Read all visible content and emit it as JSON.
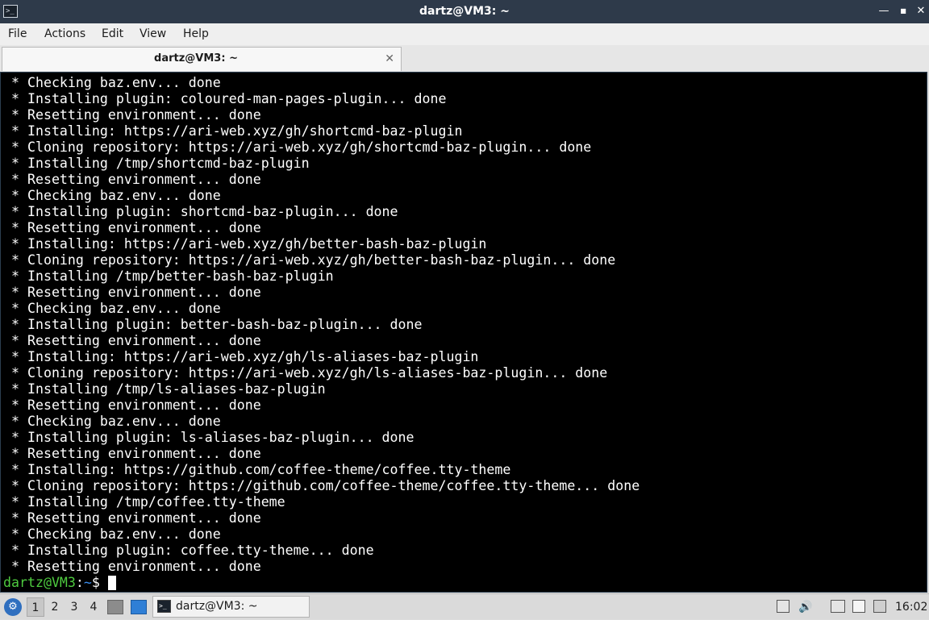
{
  "window": {
    "title": "dartz@VM3: ~",
    "app_icon": "terminal-icon",
    "controls": [
      "minimize",
      "maximize",
      "close"
    ]
  },
  "menubar": {
    "items": [
      "File",
      "Actions",
      "Edit",
      "View",
      "Help"
    ]
  },
  "tabs": [
    {
      "label": "dartz@VM3: ~",
      "close_glyph": "✕"
    }
  ],
  "terminal": {
    "background": "#000000",
    "foreground": "#ffffff",
    "lines": [
      " * Checking baz.env... done",
      " * Installing plugin: coloured-man-pages-plugin... done",
      " * Resetting environment... done",
      " * Installing: https://ari-web.xyz/gh/shortcmd-baz-plugin",
      " * Cloning repository: https://ari-web.xyz/gh/shortcmd-baz-plugin... done",
      " * Installing /tmp/shortcmd-baz-plugin",
      " * Resetting environment... done",
      " * Checking baz.env... done",
      " * Installing plugin: shortcmd-baz-plugin... done",
      " * Resetting environment... done",
      " * Installing: https://ari-web.xyz/gh/better-bash-baz-plugin",
      " * Cloning repository: https://ari-web.xyz/gh/better-bash-baz-plugin... done",
      " * Installing /tmp/better-bash-baz-plugin",
      " * Resetting environment... done",
      " * Checking baz.env... done",
      " * Installing plugin: better-bash-baz-plugin... done",
      " * Resetting environment... done",
      " * Installing: https://ari-web.xyz/gh/ls-aliases-baz-plugin",
      " * Cloning repository: https://ari-web.xyz/gh/ls-aliases-baz-plugin... done",
      " * Installing /tmp/ls-aliases-baz-plugin",
      " * Resetting environment... done",
      " * Checking baz.env... done",
      " * Installing plugin: ls-aliases-baz-plugin... done",
      " * Resetting environment... done",
      " * Installing: https://github.com/coffee-theme/coffee.tty-theme",
      " * Cloning repository: https://github.com/coffee-theme/coffee.tty-theme... done",
      " * Installing /tmp/coffee.tty-theme",
      " * Resetting environment... done",
      " * Checking baz.env... done",
      " * Installing plugin: coffee.tty-theme... done",
      " * Resetting environment... done"
    ],
    "prompt": {
      "user_host": "dartz@VM3",
      "colon": ":",
      "path": "~",
      "sign": "$ ",
      "user_color": "#4ecb3f",
      "path_color": "#3b8ff0"
    }
  },
  "taskbar": {
    "start_icon": "start-menu-icon",
    "workspaces": [
      "1",
      "2",
      "3",
      "4"
    ],
    "active_workspace": "1",
    "launchers": [
      "file-manager-icon",
      "show-desktop-icon"
    ],
    "task": {
      "label": "dartz@VM3: ~",
      "icon": "terminal-icon"
    },
    "tray": [
      "tray-arrow-icon",
      "volume-icon",
      "network-icon",
      "clipboard-icon",
      "notification-icon"
    ],
    "clock": "16:02"
  }
}
